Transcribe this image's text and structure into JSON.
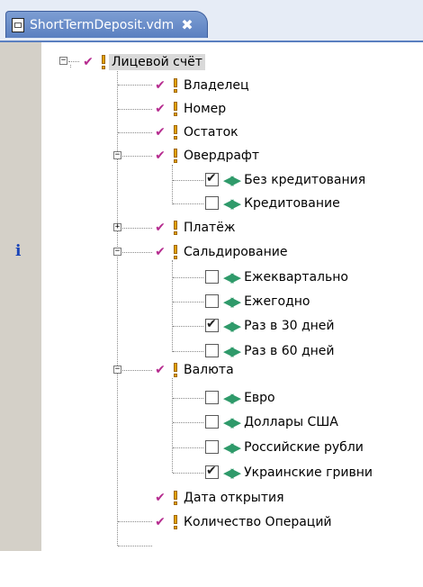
{
  "tab": {
    "title": "ShortTermDeposit.vdm",
    "close_symbol": "✖"
  },
  "ruler": {
    "info_symbol": "i"
  },
  "tree": {
    "root": "Лицевой счёт",
    "owner": "Владелец",
    "number": "Номер",
    "balance": "Остаток",
    "overdraft": {
      "label": "Овердрафт",
      "options": [
        "Без кредитования",
        "Кредитование"
      ],
      "checked": [
        true,
        false
      ]
    },
    "payment": "Платёж",
    "settlement": {
      "label": "Сальдирование",
      "options": [
        "Ежеквартально",
        "Ежегодно",
        "Раз в 30 дней",
        "Раз в 60 дней"
      ],
      "checked": [
        false,
        false,
        true,
        false
      ]
    },
    "currency": {
      "label": "Валюта",
      "options": [
        "Евро",
        "Доллары США",
        "Российские рубли",
        "Украинские гривни"
      ],
      "checked": [
        false,
        false,
        false,
        true
      ]
    },
    "open_date": "Дата открытия",
    "operations_count": "Количество Операций"
  },
  "colors": {
    "feature_check": "#b62c8f",
    "alternative": "#2f9a6a",
    "tab": "#5a7fc0",
    "ruler": "#d4d0c8"
  },
  "icons": {
    "feature_check": "check-icon",
    "mandatory": "exclamation-icon",
    "alternative": "alternative-arrows-icon",
    "info": "info-icon"
  }
}
